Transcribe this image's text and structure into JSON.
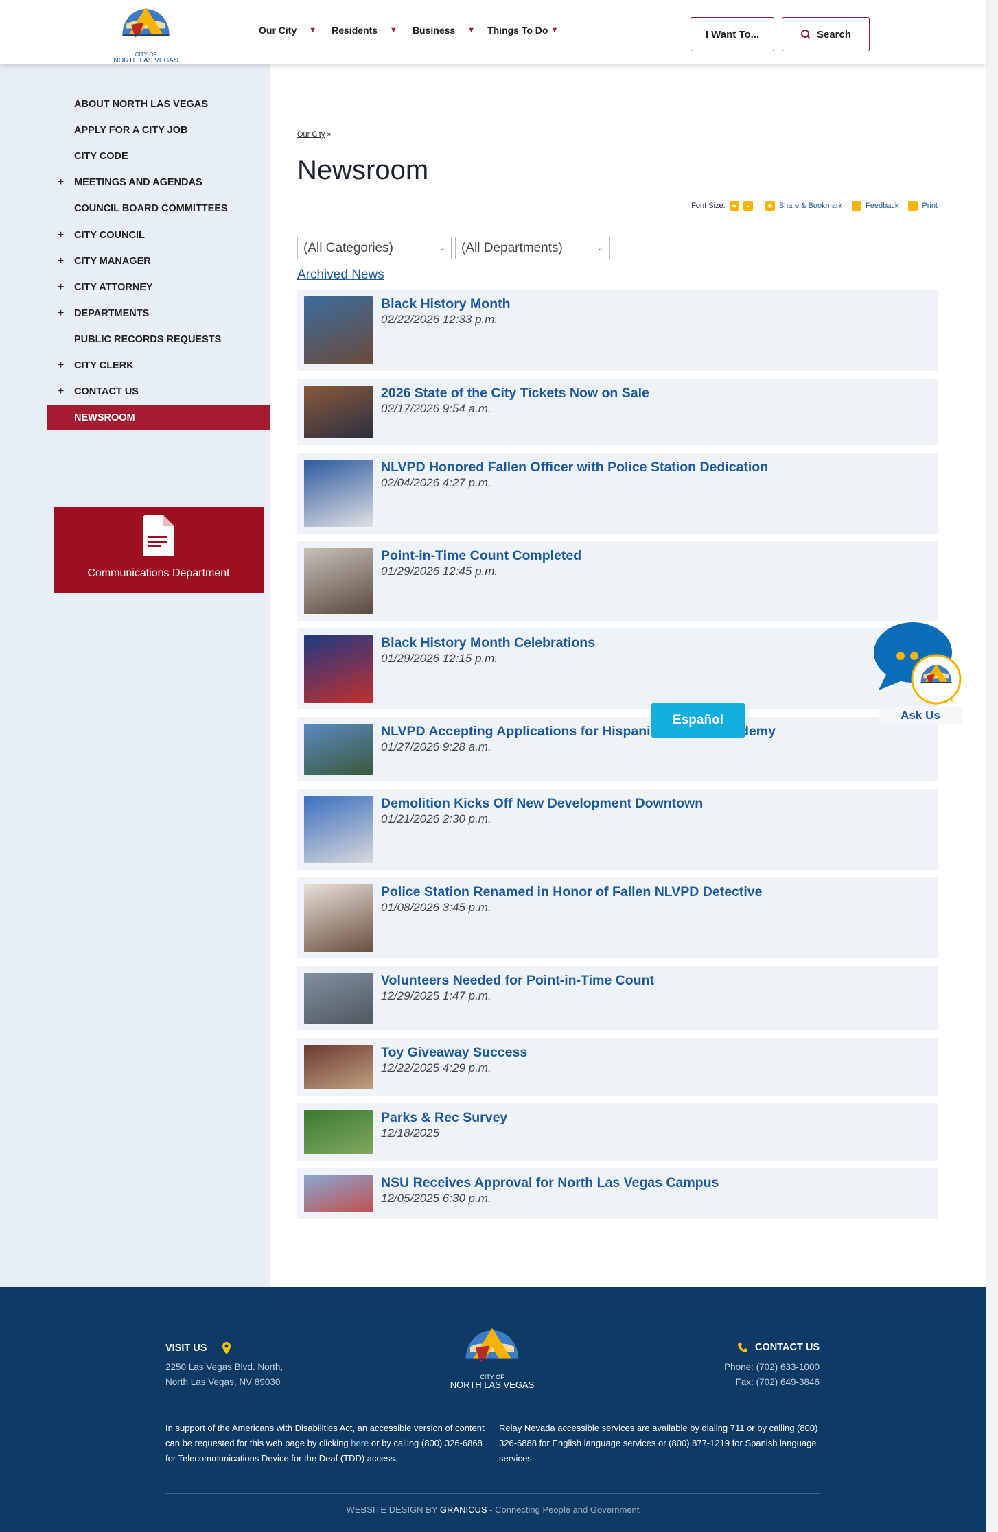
{
  "header": {
    "logo_text": [
      "CITY OF",
      "NORTH LAS VEGAS"
    ],
    "nav": [
      {
        "label": "Our City"
      },
      {
        "label": "Residents"
      },
      {
        "label": "Business"
      },
      {
        "label": "Things To Do"
      }
    ],
    "i_want_to": "I Want To...",
    "search": "Search"
  },
  "sidebar": {
    "items": [
      {
        "label": "ABOUT NORTH LAS VEGAS",
        "expandable": false
      },
      {
        "label": "APPLY FOR A CITY JOB",
        "expandable": false
      },
      {
        "label": "CITY CODE",
        "expandable": false
      },
      {
        "label": "MEETINGS AND AGENDAS",
        "expandable": true
      },
      {
        "label": "COUNCIL BOARD COMMITTEES",
        "expandable": false
      },
      {
        "label": "CITY COUNCIL",
        "expandable": true
      },
      {
        "label": "CITY MANAGER",
        "expandable": true
      },
      {
        "label": "CITY ATTORNEY",
        "expandable": true
      },
      {
        "label": "DEPARTMENTS",
        "expandable": true
      },
      {
        "label": "PUBLIC RECORDS REQUESTS",
        "expandable": false
      },
      {
        "label": "CITY CLERK",
        "expandable": true
      },
      {
        "label": "CONTACT US",
        "expandable": true
      },
      {
        "label": "NEWSROOM",
        "expandable": false,
        "active": true
      }
    ],
    "plus": "+",
    "dept_box": "Communications Department"
  },
  "main": {
    "breadcrumb": "Our City",
    "breadcrumb_sep": "»",
    "title": "Newsroom",
    "tools": {
      "font_size": "Font Size:",
      "share": "Share & Bookmark",
      "feedback": "Feedback",
      "print": "Print"
    },
    "category_filter": "(All Categories)",
    "department_filter": "(All Departments)",
    "archived": "Archived News",
    "news": [
      {
        "title": "Black History Month",
        "date": "02/22/2026 12:33 p.m."
      },
      {
        "title": "2026 State of the City Tickets Now on Sale",
        "date": "02/17/2026 9:54 a.m."
      },
      {
        "title": "NLVPD Honored Fallen Officer with Police Station Dedication",
        "date": "02/04/2026 4:27 p.m."
      },
      {
        "title": "Point-in-Time Count Completed",
        "date": "01/29/2026 12:45 p.m."
      },
      {
        "title": "Black History Month Celebrations",
        "date": "01/29/2026 12:15 p.m."
      },
      {
        "title": "NLVPD Accepting Applications for Hispanic Citizens Academy",
        "date": "01/27/2026 9:28 a.m."
      },
      {
        "title": "Demolition Kicks Off New Development Downtown",
        "date": "01/21/2026 2:30 p.m."
      },
      {
        "title": "Police Station Renamed in Honor of Fallen NLVPD Detective",
        "date": "01/08/2026 3:45 p.m."
      },
      {
        "title": "Volunteers Needed for Point-in-Time Count",
        "date": "12/29/2025 1:47 p.m."
      },
      {
        "title": "Toy Giveaway Success",
        "date": "12/22/2025 4:29 p.m."
      },
      {
        "title": "Parks & Rec Survey",
        "date": "12/18/2025"
      },
      {
        "title": "NSU Receives Approval for North Las Vegas Campus",
        "date": "12/05/2025 6:30 p.m."
      }
    ]
  },
  "widgets": {
    "espanol": "Español",
    "ask_us": "Ask Us"
  },
  "footer": {
    "visit_us": "VISIT US",
    "address": [
      "2250 Las Vegas Blvd. North,",
      "North Las Vegas, NV 89030"
    ],
    "contact_us": "CONTACT US",
    "phone": "Phone: (702) 633-1000",
    "fax": "Fax: (702) 649-3846",
    "ada_pre": "In support of the Americans with Disabilities Act, an accessible version of content can be requested for this web page by clicking ",
    "ada_link": "here",
    "ada_post": " or by calling (800) 326-6868 for Telecommunications Device for the Deaf (TDD) access.",
    "relay": "Relay Nevada accessible services are available by dialing 711 or by calling (800) 326-6888 for English language services or (800) 877-1219 for Spanish language services.",
    "credit_pre": "WEBSITE DESIGN BY",
    "credit_brand": "GRANICUS",
    "credit_post": "- Connecting People and Government"
  }
}
